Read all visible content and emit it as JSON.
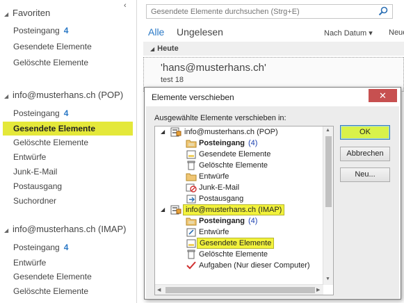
{
  "nav": {
    "collapse_glyph": "‹",
    "favorites": {
      "title": "Favoriten",
      "items": [
        {
          "label": "Posteingang",
          "count": "4"
        },
        {
          "label": "Gesendete Elemente",
          "count": ""
        },
        {
          "label": "Gelöschte Elemente",
          "count": ""
        }
      ]
    },
    "pop": {
      "title": "info@musterhans.ch (POP)",
      "items": [
        {
          "label": "Posteingang",
          "count": "4"
        },
        {
          "label": "Gesendete Elemente",
          "count": ""
        },
        {
          "label": "Gelöschte Elemente",
          "count": ""
        },
        {
          "label": "Entwürfe",
          "count": ""
        },
        {
          "label": "Junk-E-Mail",
          "count": ""
        },
        {
          "label": "Postausgang",
          "count": ""
        },
        {
          "label": "Suchordner",
          "count": ""
        }
      ]
    },
    "imap": {
      "title": "info@musterhans.ch (IMAP)",
      "items": [
        {
          "label": "Posteingang",
          "count": "4"
        },
        {
          "label": "Entwürfe",
          "count": ""
        },
        {
          "label": "Gesendete Elemente",
          "count": ""
        },
        {
          "label": "Gelöschte Elemente",
          "count": ""
        }
      ]
    }
  },
  "main": {
    "search_placeholder": "Gesendete Elemente durchsuchen (Strg+E)",
    "filter_all": "Alle",
    "filter_unread": "Ungelesen",
    "sort_label": "Nach Datum ▾",
    "sort_new": "Neue",
    "group_label": "Heute",
    "message": {
      "from": "'hans@musterhans.ch'",
      "subject": "test 18"
    }
  },
  "dialog": {
    "title": "Elemente verschieben",
    "close": "✕",
    "label": "Ausgewählte Elemente verschieben in:",
    "ok": "OK",
    "cancel": "Abbrechen",
    "new": "Neu...",
    "tree": {
      "pop_account": "info@musterhans.ch (POP)",
      "pop_folders": [
        {
          "label": "Posteingang",
          "count": "(4)"
        },
        {
          "label": "Gesendete Elemente",
          "count": ""
        },
        {
          "label": "Gelöschte Elemente",
          "count": ""
        },
        {
          "label": "Entwürfe",
          "count": ""
        },
        {
          "label": "Junk-E-Mail",
          "count": ""
        },
        {
          "label": "Postausgang",
          "count": ""
        }
      ],
      "imap_account": "info@musterhans.ch (IMAP)",
      "imap_folders": [
        {
          "label": "Posteingang",
          "count": "(4)"
        },
        {
          "label": "Entwürfe",
          "count": ""
        },
        {
          "label": "Gesendete Elemente",
          "count": ""
        },
        {
          "label": "Gelöschte Elemente",
          "count": ""
        },
        {
          "label": "Aufgaben (Nur dieser Computer)",
          "count": ""
        }
      ]
    }
  },
  "colors": {
    "highlight": "#e4e83a",
    "accent": "#2b79c6",
    "ok_button": "#d9f24a",
    "close_button": "#c75050"
  }
}
